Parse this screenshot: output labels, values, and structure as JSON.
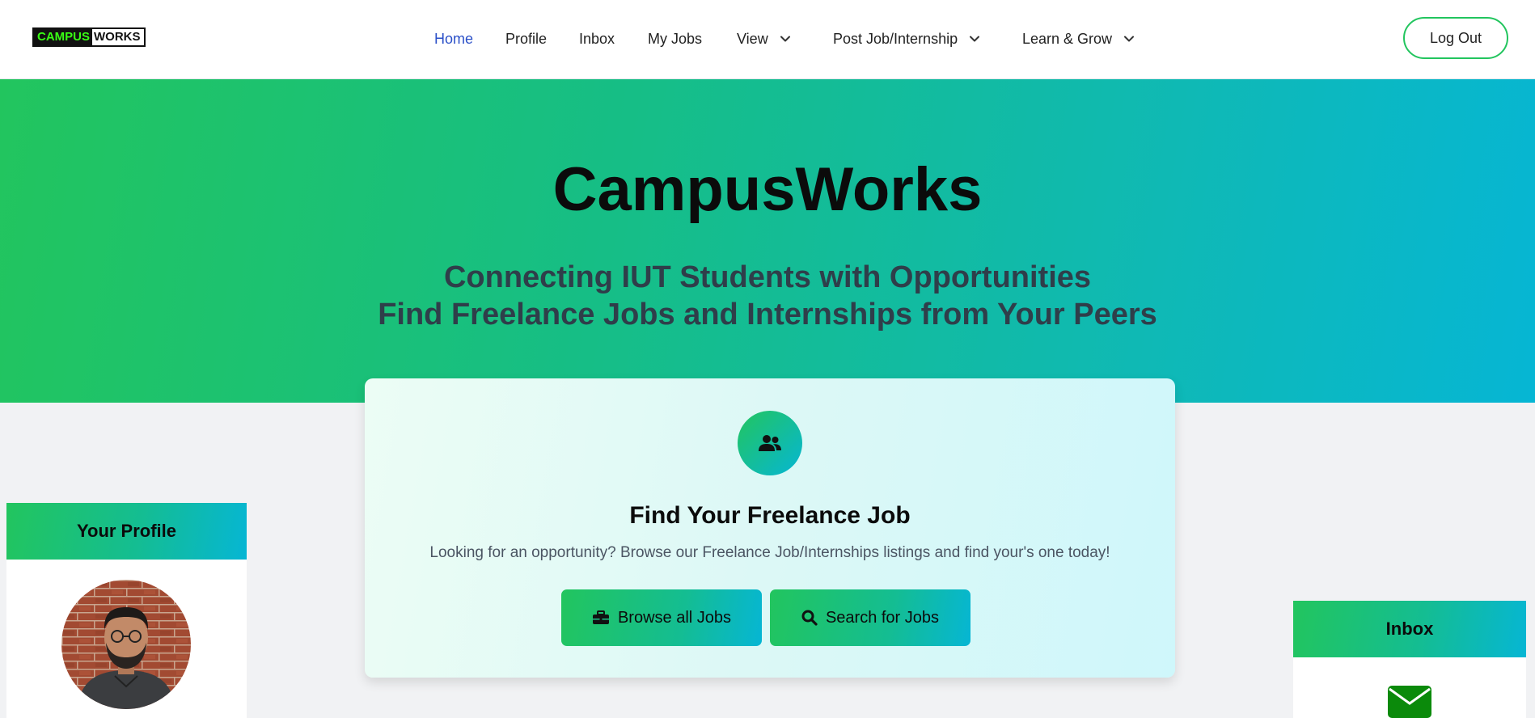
{
  "navbar": {
    "logo_part1": "CAMPUS",
    "logo_part2": "WORKS",
    "items": [
      {
        "label": "Home",
        "active": true
      },
      {
        "label": "Profile"
      },
      {
        "label": "Inbox"
      },
      {
        "label": "My Jobs"
      },
      {
        "label": "View",
        "dropdown": true
      },
      {
        "label": "Post Job/Internship",
        "dropdown": true
      },
      {
        "label": "Learn & Grow",
        "dropdown": true
      }
    ],
    "logout_label": "Log Out"
  },
  "hero": {
    "title": "CampusWorks",
    "subtitle_line1": "Connecting IUT Students with Opportunities",
    "subtitle_line2": "Find Freelance Jobs and Internships from Your Peers"
  },
  "find_card": {
    "icon": "users-icon",
    "title": "Find Your Freelance Job",
    "description": "Looking for an opportunity? Browse our Freelance Job/Internships listings and find your's one today!",
    "browse_label": "Browse all Jobs",
    "browse_icon": "briefcase-icon",
    "search_label": "Search for Jobs",
    "search_icon": "search-icon"
  },
  "profile_card": {
    "title": "Your Profile"
  },
  "inbox_card": {
    "title": "Inbox",
    "icon": "envelope-icon"
  },
  "colors": {
    "gradient_start": "#22c55e",
    "gradient_end": "#06b6d4",
    "active_nav": "#2b50c8",
    "logo_green": "#39ff14"
  }
}
